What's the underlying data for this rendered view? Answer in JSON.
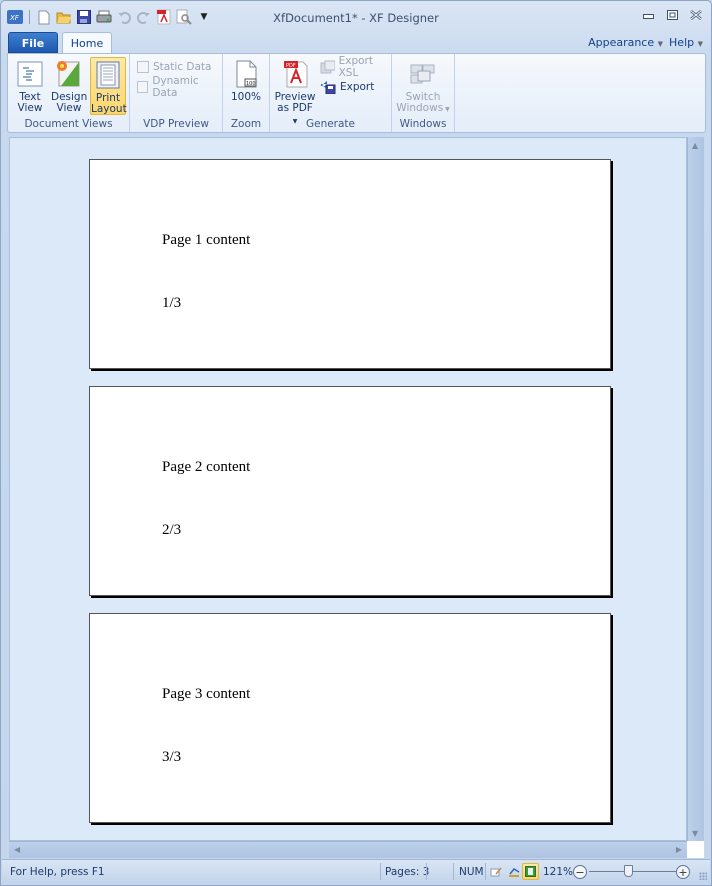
{
  "window": {
    "title": "XfDocument1* - XF Designer",
    "controls": {
      "minimize": "minimize",
      "maximize": "maximize",
      "close": "close"
    }
  },
  "quick_access": [
    {
      "name": "app-logo-icon",
      "glyph": "XF"
    },
    {
      "name": "new-document-icon"
    },
    {
      "name": "open-folder-icon"
    },
    {
      "name": "save-icon"
    },
    {
      "name": "print-icon"
    },
    {
      "name": "undo-icon"
    },
    {
      "name": "redo-icon"
    },
    {
      "name": "pdf-icon"
    },
    {
      "name": "print-preview-icon"
    },
    {
      "name": "customize-dropdown-icon"
    }
  ],
  "tabs": {
    "file": "File",
    "home": "Home"
  },
  "right_menu": {
    "appearance": "Appearance",
    "help": "Help"
  },
  "ribbon": {
    "document_views": {
      "label": "Document Views",
      "text_view": [
        "Text",
        "View"
      ],
      "design_view": [
        "Design",
        "View"
      ],
      "print_layout": [
        "Print",
        "Layout"
      ]
    },
    "vdp_preview": {
      "label": "VDP Preview",
      "static_data": "Static Data",
      "dynamic_data": "Dynamic Data"
    },
    "zoom": {
      "label": "Zoom",
      "zoom_100": "100%"
    },
    "generate": {
      "label": "Generate",
      "preview_pdf": [
        "Preview",
        "as PDF"
      ],
      "export_xsl": "Export XSL",
      "export": "Export"
    },
    "windows": {
      "label": "Windows",
      "switch_windows": [
        "Switch",
        "Windows"
      ]
    }
  },
  "document": {
    "pages": [
      {
        "content": "Page 1 content",
        "number": "1/3"
      },
      {
        "content": "Page 2 content",
        "number": "2/3"
      },
      {
        "content": "Page 3 content",
        "number": "3/3"
      }
    ]
  },
  "status": {
    "help": "For Help, press F1",
    "pages": "Pages: 3",
    "num": "NUM",
    "zoom": "121%",
    "zoom_level_percent": 121
  },
  "colors": {
    "accent_file_tab": "#1e58b1",
    "active_button": "#fbd66d",
    "canvas_bg": "#dce9f9"
  }
}
